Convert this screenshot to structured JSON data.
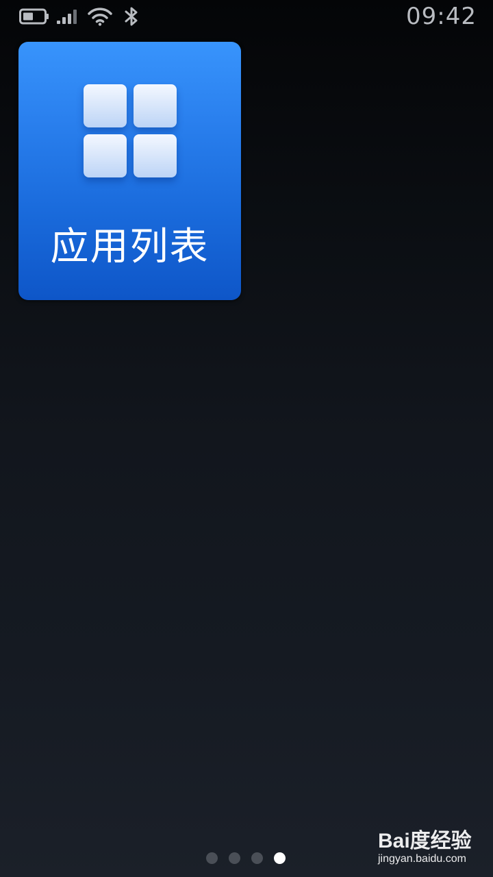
{
  "status_bar": {
    "time": "09:42",
    "icons": [
      "battery-icon",
      "signal-icon",
      "wifi-icon",
      "bluetooth-icon"
    ],
    "icon_color": "#b9bcc1"
  },
  "home": {
    "tile": {
      "label": "应用列表",
      "icon": "app-grid-icon",
      "color": "#1a6bdc"
    }
  },
  "page_indicator": {
    "total": 4,
    "active_index": 4
  },
  "watermark": {
    "logo": "Bai度经验",
    "url": "jingyan.baidu.com"
  }
}
